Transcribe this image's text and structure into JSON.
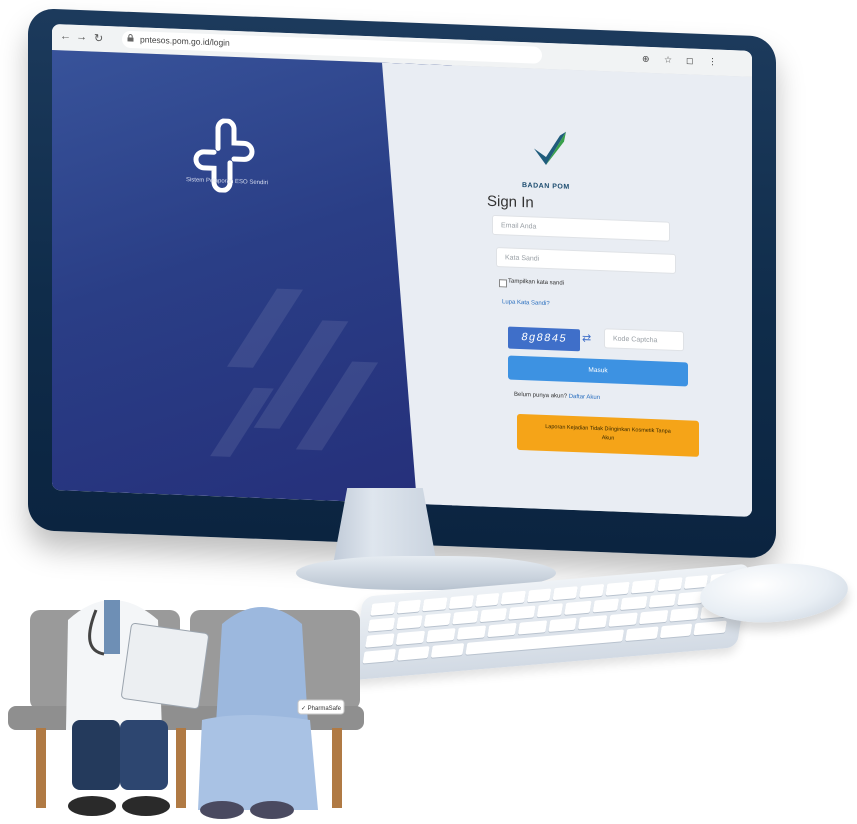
{
  "browser": {
    "url": "pntesos.pom.go.id/login",
    "nav_back": "←",
    "nav_forward": "→",
    "nav_reload": "↻",
    "toolbar_icons": [
      "⊕",
      "☆",
      "◻",
      "⋮"
    ]
  },
  "left_panel": {
    "tagline": "Sistem Pelaporan ESO Sendiri"
  },
  "login": {
    "brand_name": "BADAN POM",
    "title": "Sign In",
    "email_placeholder": "Email Anda",
    "password_placeholder": "Kata Sandi",
    "show_password_label": "Tampilkan kata sandi",
    "forgot_link": "Lupa Kata Sandi?",
    "captcha_value": "8g8845",
    "captcha_placeholder": "Kode Captcha",
    "submit_label": "Masuk",
    "register_prompt": "Belum punya akun?",
    "register_link": "Daftar Akun",
    "service_button_line1": "Laporan Kejadian Tidak Diinginkan Kosmetik Tanpa",
    "service_button_line2": "Akun"
  },
  "bench_tag": "✓ PharmaSafe",
  "colors": {
    "left_panel": "#2a3e86",
    "submit": "#3d92e2",
    "service_button": "#f5a418",
    "captcha": "#3f6fc9",
    "bezel": "#0f2c4a",
    "bench_seat": "#8f8f8f"
  }
}
